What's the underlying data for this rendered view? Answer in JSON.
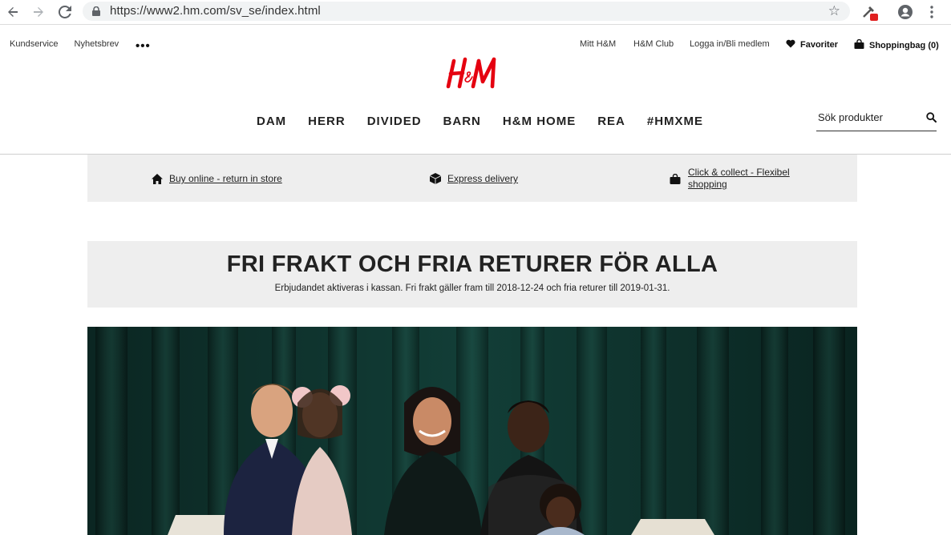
{
  "browser": {
    "url": "https://www2.hm.com/sv_se/index.html"
  },
  "utility": {
    "left_links": [
      "Kundservice",
      "Nyhetsbrev"
    ],
    "more": "•••",
    "right_links": [
      "Mitt H&M",
      "H&M Club",
      "Logga in/Bli medlem"
    ],
    "favorites": "Favoriter",
    "bag": "Shoppingbag (0)"
  },
  "brand": {
    "logo_text": "H&M",
    "color": "#e50010"
  },
  "main_nav": [
    "DAM",
    "HERR",
    "DIVIDED",
    "BARN",
    "H&M HOME",
    "REA",
    "#HMXME"
  ],
  "search": {
    "placeholder": "Sök produkter"
  },
  "services": [
    {
      "label": "Buy online - return in store",
      "icon": "home-icon"
    },
    {
      "label": "Express delivery",
      "icon": "package-icon"
    },
    {
      "label": "Click & collect - Flexibel shopping",
      "icon": "bag-icon"
    }
  ],
  "promo": {
    "title": "FRI FRAKT OCH FRIA RETURER FÖR ALLA",
    "subtitle": "Erbjudandet aktiveras i kassan. Fri frakt gäller fram till 2018-12-24 och fria returer till 2019-01-31."
  }
}
